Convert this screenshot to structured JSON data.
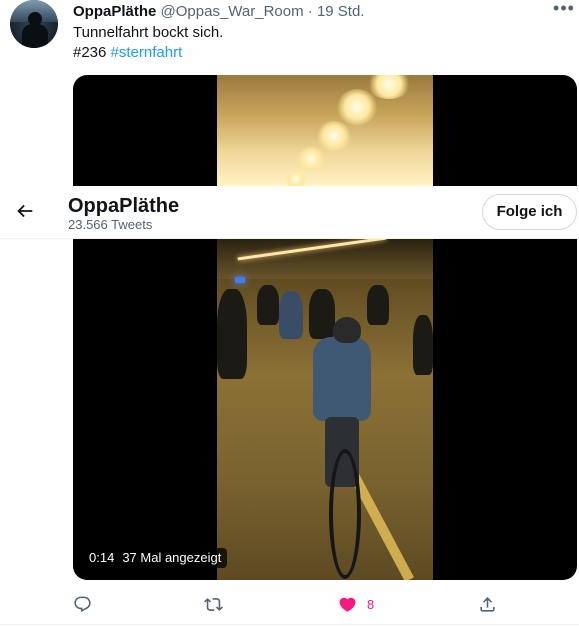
{
  "tweet": {
    "author_name": "OppaPläthe",
    "author_handle": "@Oppas_War_Room",
    "separator": " · ",
    "time": "19 Std.",
    "text_line1": "Tunnelfahrt bockt sich.",
    "hashtag1": "#236",
    "hashtag2": "#sternfahrt",
    "more_label": "•••"
  },
  "video": {
    "duration": "0:14",
    "views": "37 Mal angezeigt"
  },
  "sticky_header": {
    "name": "OppaPläthe",
    "tweet_count": "23.566 Tweets",
    "follow_label": "Folge ich"
  },
  "actions": {
    "like_count": "8",
    "liked": true
  },
  "colors": {
    "accent": "#1d9bf0",
    "like": "#f91880",
    "muted": "#536471"
  },
  "icons": [
    "back-arrow-icon",
    "reply-icon",
    "retweet-icon",
    "heart-icon",
    "share-icon",
    "more-icon"
  ]
}
